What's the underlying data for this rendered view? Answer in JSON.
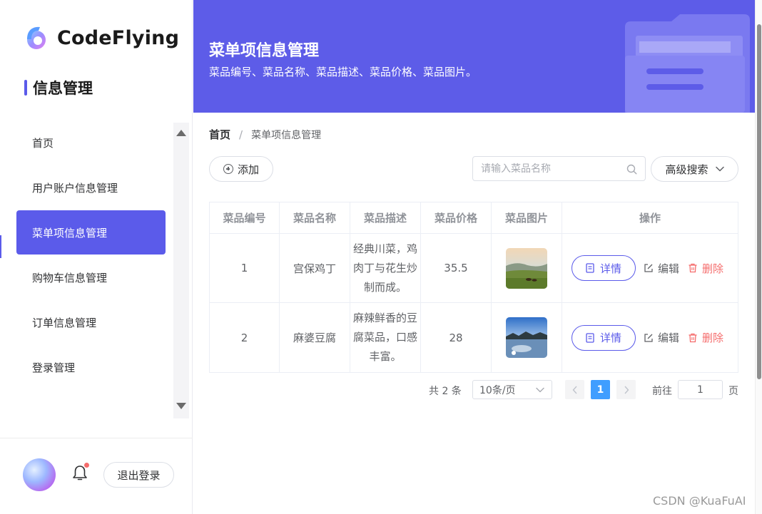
{
  "app": {
    "name": "CodeFlying",
    "section": "信息管理"
  },
  "sidebar": {
    "items": [
      {
        "label": "首页",
        "active": false
      },
      {
        "label": "用户账户信息管理",
        "active": false
      },
      {
        "label": "菜单项信息管理",
        "active": true
      },
      {
        "label": "购物车信息管理",
        "active": false
      },
      {
        "label": "订单信息管理",
        "active": false
      },
      {
        "label": "登录管理",
        "active": false
      }
    ],
    "logout_label": "退出登录"
  },
  "banner": {
    "title": "菜单项信息管理",
    "subtitle": "菜品编号、菜品名称、菜品描述、菜品价格、菜品图片。",
    "accent_color": "#5d5ce8"
  },
  "breadcrumb": {
    "home": "首页",
    "separator": "/",
    "current": "菜单项信息管理"
  },
  "toolbar": {
    "add_label": "添加",
    "search_placeholder": "请输入菜品名称",
    "advanced_label": "高级搜索"
  },
  "table": {
    "columns": [
      "菜品编号",
      "菜品名称",
      "菜品描述",
      "菜品价格",
      "菜品图片",
      "操作"
    ],
    "rows": [
      {
        "id": "1",
        "name": "宫保鸡丁",
        "desc": "经典川菜，鸡肉丁与花生炒制而成。",
        "price": "35.5",
        "image": "landscape-meadow"
      },
      {
        "id": "2",
        "name": "麻婆豆腐",
        "desc": "麻辣鲜香的豆腐菜品，口感丰富。",
        "price": "28",
        "image": "landscape-lake"
      }
    ],
    "actions": {
      "detail": "详情",
      "edit": "编辑",
      "delete": "删除"
    }
  },
  "pagination": {
    "total_text": "共 2 条",
    "page_size": "10条/页",
    "current_page": "1",
    "goto_label": "前往",
    "goto_value": "1",
    "goto_unit": "页"
  },
  "watermark": "CSDN @KuaFuAI"
}
